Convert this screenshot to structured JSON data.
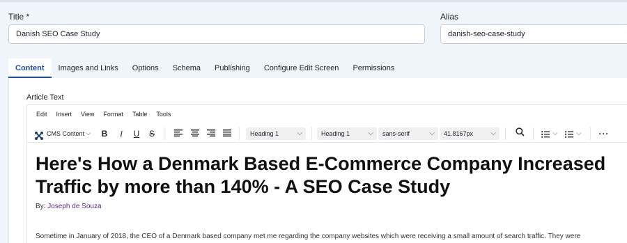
{
  "fields": {
    "title_label": "Title *",
    "title_value": "Danish SEO Case Study",
    "alias_label": "Alias",
    "alias_value": "danish-seo-case-study"
  },
  "tabs": [
    {
      "label": "Content",
      "active": true
    },
    {
      "label": "Images and Links"
    },
    {
      "label": "Options"
    },
    {
      "label": "Schema"
    },
    {
      "label": "Publishing"
    },
    {
      "label": "Configure Edit Screen"
    },
    {
      "label": "Permissions"
    }
  ],
  "editor": {
    "label": "Article Text",
    "menu": [
      "Edit",
      "Insert",
      "View",
      "Format",
      "Table",
      "Tools"
    ],
    "toolbar": {
      "cms_content": "CMS Content",
      "block_format": "Heading 1",
      "styles": "Heading 1",
      "font_family": "sans-serif",
      "font_size": "41.8167px",
      "icons": [
        "joomla-icon",
        "bold-icon",
        "italic-icon",
        "underline-icon",
        "strikethrough-icon",
        "align-left-icon",
        "align-center-icon",
        "align-right-icon",
        "align-justify-icon",
        "search-icon",
        "bullet-list-icon",
        "numbered-list-icon",
        "more-icon"
      ]
    },
    "content": {
      "heading": "Here's How a Denmark Based E-Commerce Company Increased Traffic by more than 140% - A SEO Case Study",
      "byline_prefix": "By:",
      "author": "Joseph de Souza",
      "paragraph": "Sometime in January of 2018, the CEO of a Denmark based company met me regarding the company websites which were receiving a small amount of search traffic. They were"
    }
  },
  "colors": {
    "accent": "#1f4e9a",
    "author_link": "#5b2a86",
    "background": "#f0f4fb"
  }
}
